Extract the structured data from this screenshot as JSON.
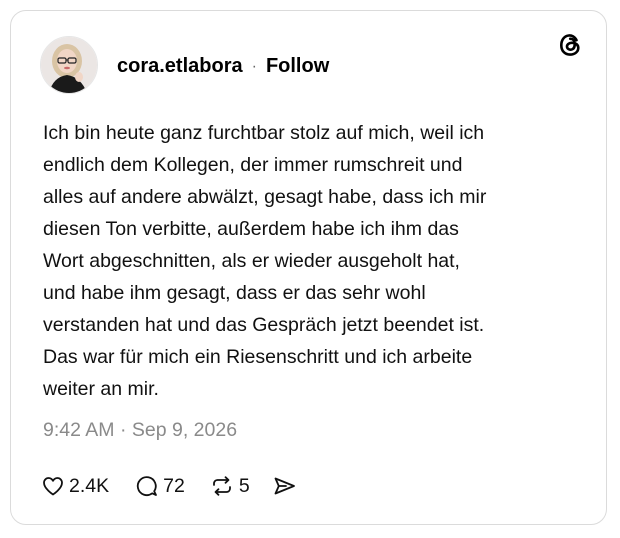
{
  "post": {
    "username": "cora.etlabora",
    "separator": "·",
    "follow_label": "Follow",
    "lines": [
      "Ich bin heute ganz furchtbar stolz auf mich, weil ich",
      "endlich dem Kollegen, der immer rumschreit und",
      "alles auf andere abwälzt, gesagt habe, dass ich mir",
      "diesen Ton verbitte, außerdem habe ich ihm das",
      "Wort abgeschnitten, als er wieder ausgeholt hat,",
      "und habe ihm gesagt, dass er das sehr wohl",
      "verstanden hat und das Gespräch jetzt beendet ist.",
      "Das war für mich ein Riesenschritt und ich arbeite",
      "weiter an mir."
    ],
    "timestamp": "9:42 AM · Sep 9, 2026"
  },
  "stats": {
    "likes": "2.4K",
    "replies": "72",
    "reposts": "5"
  },
  "icons": {
    "logo": "threads-logo-icon",
    "like": "heart-icon",
    "reply": "comment-icon",
    "repost": "repost-icon",
    "share": "send-icon"
  },
  "colors": {
    "text": "#111111",
    "muted": "#8a8a8a",
    "border": "#dbdbdb"
  }
}
